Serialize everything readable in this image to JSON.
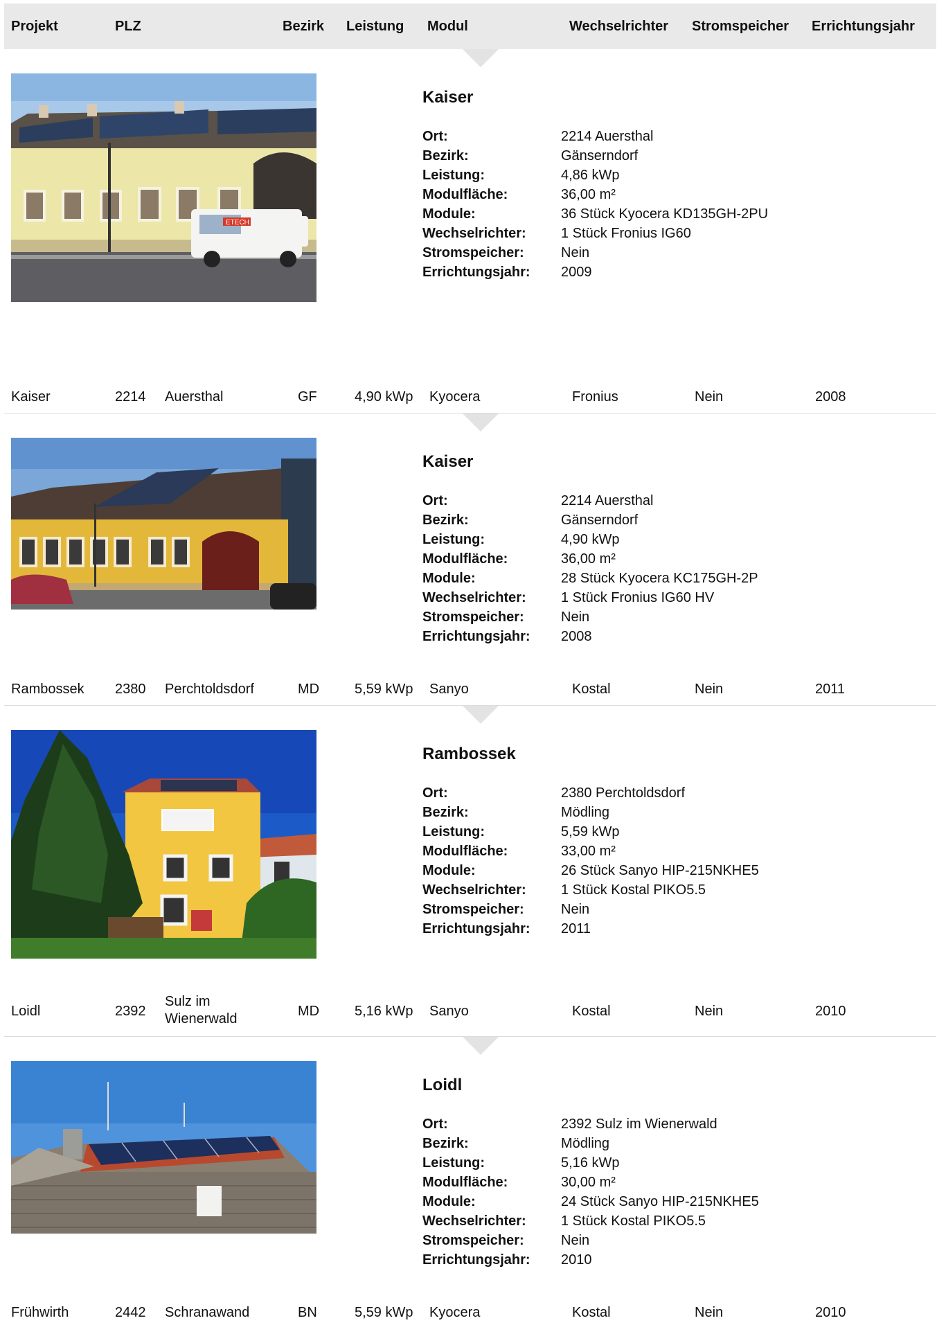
{
  "table": {
    "headers": [
      "Projekt",
      "PLZ",
      "Bezirk",
      "Leistung",
      "Modul",
      "Wechselrichter",
      "Stromspeicher",
      "Errichtungsjahr"
    ]
  },
  "detail_labels": {
    "ort": "Ort:",
    "bezirk": "Bezirk:",
    "leistung": "Leistung:",
    "modulflaeche": "Modulfläche:",
    "module": "Module:",
    "wechselrichter": "Wechselrichter:",
    "stromspeicher": "Stromspeicher:",
    "errichtungsjahr": "Errichtungsjahr:"
  },
  "rows": [
    {
      "projekt": "Kaiser",
      "plz": "2214",
      "ort": "Auersthal",
      "bezirk": "GF",
      "leistung": "4,90 kWp",
      "modul": "Kyocera",
      "wechselrichter": "Fronius",
      "stromspeicher": "Nein",
      "jahr": "2008"
    },
    {
      "projekt": "Rambossek",
      "plz": "2380",
      "ort": "Perchtoldsdorf",
      "bezirk": "MD",
      "leistung": "5,59 kWp",
      "modul": "Sanyo",
      "wechselrichter": "Kostal",
      "stromspeicher": "Nein",
      "jahr": "2011"
    },
    {
      "projekt": "Loidl",
      "plz": "2392",
      "ort": "Sulz im Wienerwald",
      "bezirk": "MD",
      "leistung": "5,16 kWp",
      "modul": "Sanyo",
      "wechselrichter": "Kostal",
      "stromspeicher": "Nein",
      "jahr": "2010"
    },
    {
      "projekt": "Frühwirth",
      "plz": "2442",
      "ort": "Schranawand",
      "bezirk": "BN",
      "leistung": "5,59 kWp",
      "modul": "Kyocera",
      "wechselrichter": "Kostal",
      "stromspeicher": "Nein",
      "jahr": "2010"
    }
  ],
  "details": [
    {
      "title": "Kaiser",
      "ort": "2214 Auersthal",
      "bezirk": "Gänserndorf",
      "leistung": "4,86 kWp",
      "modulflaeche": "36,00 m²",
      "module": "36 Stück Kyocera KD135GH-2PU",
      "wechselrichter": "1 Stück Fronius IG60",
      "stromspeicher": "Nein",
      "errichtungsjahr": "2009",
      "van_text": "ETECH"
    },
    {
      "title": "Kaiser",
      "ort": "2214 Auersthal",
      "bezirk": "Gänserndorf",
      "leistung": "4,90 kWp",
      "modulflaeche": "36,00 m²",
      "module": "28 Stück Kyocera KC175GH-2P",
      "wechselrichter": "1 Stück Fronius IG60 HV",
      "stromspeicher": "Nein",
      "errichtungsjahr": "2008"
    },
    {
      "title": "Rambossek",
      "ort": "2380 Perchtoldsdorf",
      "bezirk": "Mödling",
      "leistung": "5,59 kWp",
      "modulflaeche": "33,00 m²",
      "module": "26 Stück Sanyo HIP-215NKHE5",
      "wechselrichter": "1 Stück Kostal PIKO5.5",
      "stromspeicher": "Nein",
      "errichtungsjahr": "2011"
    },
    {
      "title": "Loidl",
      "ort": "2392 Sulz im Wienerwald",
      "bezirk": "Mödling",
      "leistung": "5,16 kWp",
      "modulflaeche": "30,00 m²",
      "module": "24 Stück Sanyo HIP-215NKHE5",
      "wechselrichter": "1 Stück Kostal PIKO5.5",
      "stromspeicher": "Nein",
      "errichtungsjahr": "2010"
    }
  ]
}
